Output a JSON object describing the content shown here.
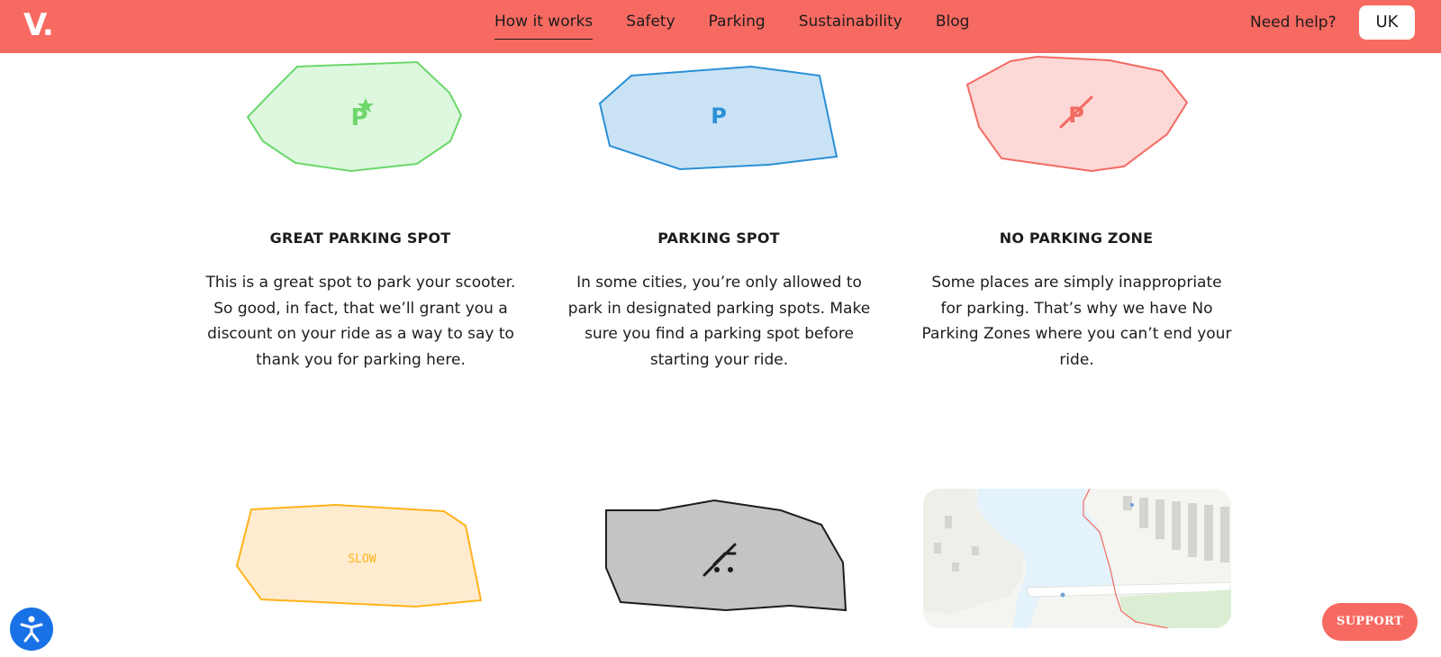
{
  "header": {
    "logo": "V.",
    "nav": [
      "How it works",
      "Safety",
      "Parking",
      "Sustainability",
      "Blog"
    ],
    "active_nav": "How it works",
    "help_label": "Need help?",
    "lang_label": "UK",
    "bg_color": "#f76a61"
  },
  "zones": [
    {
      "title": "GREAT PARKING SPOT",
      "text": "This is a great spot to park your scooter. So good, in fact, that we’ll grant you a discount on your ride as a way to say to thank you for parking here.",
      "icon": "parking-star-icon",
      "color": "#6cd76a"
    },
    {
      "title": "PARKING SPOT",
      "text": "In some cities, you’re only allowed to park in designated parking spots. Make sure you find a parking spot before starting your ride.",
      "icon": "parking-icon",
      "icon_text": "P",
      "color": "#2b8fd6"
    },
    {
      "title": "NO PARKING ZONE",
      "text": "Some places are simply inappropriate for parking. That’s why we have No Parking Zones where you can’t end your ride.",
      "icon": "no-parking-icon",
      "color": "#f26b63"
    },
    {
      "label": "SLOW",
      "icon": "slow-zone-icon",
      "color": "#ffb31a"
    },
    {
      "icon": "no-scooter-icon",
      "color": "#1c1c1c"
    },
    {
      "icon": "map-preview-icon"
    }
  ],
  "widgets": {
    "accessibility_icon": "accessibility-icon",
    "support_label": "SUPPORT"
  }
}
